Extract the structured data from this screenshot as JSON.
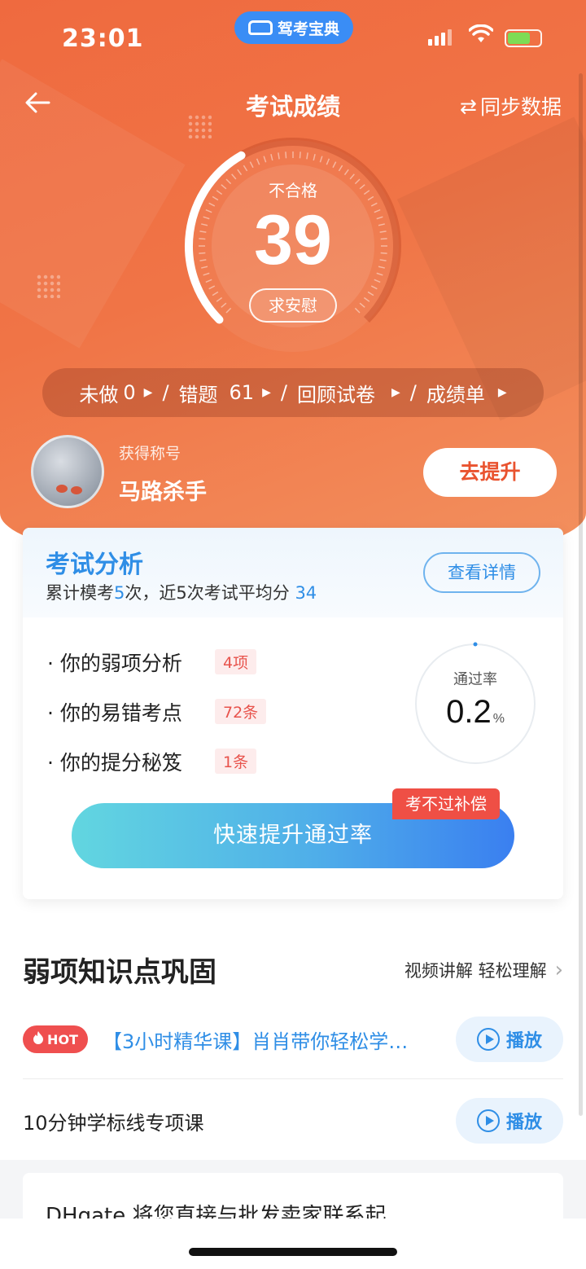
{
  "status_bar": {
    "time": "23:01",
    "app_name": "驾考宝典"
  },
  "nav": {
    "title": "考试成绩",
    "sync_label": "同步数据"
  },
  "result": {
    "status": "不合格",
    "score": "39",
    "comfort_label": "求安慰",
    "score_fraction": 0.39
  },
  "stats": {
    "undone_label": "未做",
    "undone_count": "0",
    "wrong_label": "错题",
    "wrong_count": "61",
    "review_label": "回顾试卷",
    "report_label": "成绩单"
  },
  "profile": {
    "caption": "获得称号",
    "honor": "马路杀手",
    "improve_label": "去提升"
  },
  "analysis": {
    "title": "考试分析",
    "sub_prefix": "累计模考",
    "sub_count": "5",
    "sub_mid": "次，近",
    "sub_recent": "5",
    "sub_suffix": "次考试平均分",
    "sub_avg": "34",
    "detail_label": "查看详情",
    "items": [
      {
        "label": "· 你的弱项分析",
        "tag": "4项"
      },
      {
        "label": "· 你的易错考点",
        "tag": "72条"
      },
      {
        "label": "· 你的提分秘笈",
        "tag": "1条"
      }
    ],
    "pass_label": "通过率",
    "pass_value": "0.2",
    "pass_unit": "%",
    "boost_label": "快速提升通过率",
    "compensation_tag": "考不过补偿"
  },
  "weak_section": {
    "title": "弱项知识点巩固",
    "more_label": "视频讲解 轻松理解",
    "courses": [
      {
        "hot": "HOT",
        "title": "【3小时精华课】肖肖带你轻松学…",
        "play_label": "播放"
      },
      {
        "title": "10分钟学标线专项课",
        "play_label": "播放"
      }
    ]
  },
  "ad": {
    "text": "DHgate 将您直接与批发卖家联系起"
  },
  "colors": {
    "primary_orange": "#ef6a3f",
    "accent_blue": "#2f8ee6",
    "alert_red": "#ef4f45"
  }
}
